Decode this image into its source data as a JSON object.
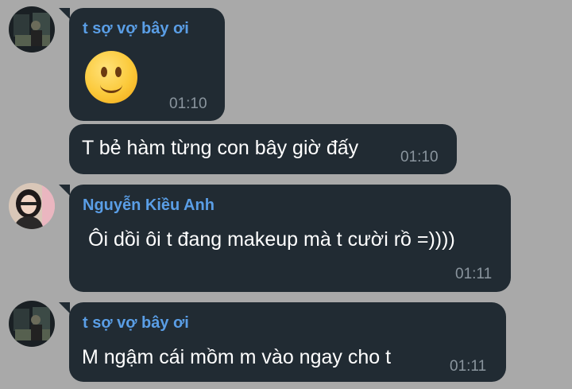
{
  "colors": {
    "background": "#a9a9a9",
    "bubble": "#212b33",
    "sender_name": "#5a9ee6",
    "timestamp": "#8a959e",
    "message_text": "#ffffff"
  },
  "messages": [
    {
      "sender": "t sợ vợ bây ơi",
      "content_type": "emoji",
      "emoji": "slightly-smiling-face-emoji",
      "time": "01:10"
    },
    {
      "sender": "",
      "content_type": "text",
      "text": "T bẻ hàm từng con bây giờ đấy",
      "time": "01:10"
    },
    {
      "sender": "Nguyễn Kiều Anh",
      "content_type": "text",
      "text": "Ôi dồi ôi t đang makeup mà t cười rồ =))))",
      "time": "01:11"
    },
    {
      "sender": "t sợ vợ bây ơi",
      "content_type": "text",
      "text": "M ngậm cái mồm m vào ngay cho t",
      "time": "01:11"
    }
  ]
}
